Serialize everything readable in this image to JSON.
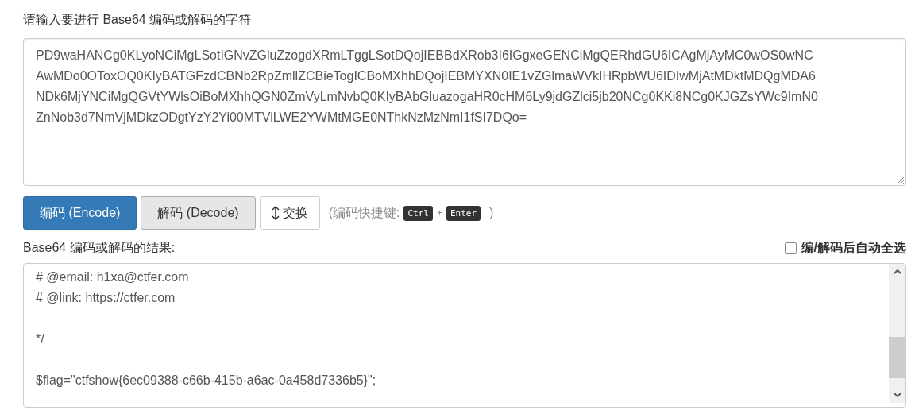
{
  "input": {
    "label": "请输入要进行 Base64 编码或解码的字符",
    "lines": [
      "PD9waHANCg0KLyoNCiMgLSotIGNvZGluZzogdXRmLTggLSotDQojIEBBdXRob3I6IGgxeGENCiMgQERhdGU6ICAgMjAyMC0wOS0wNC",
      "AwMDo0OToxOQ0KIyBATGFzdCBNb2RpZmllZCBieTogICBoMXhhDQojIEBMYXN0IE1vZGlmaWVkIHRpbWU6IDIwMjAtMDktMDQgMDA6",
      "NDk6MjYNCiMgQGVtYWlsOiBoMXhhQGN0ZmVyLmNvbQ0KIyBAbGluazogaHR0cHM6Ly9jdGZlci5jb20NCg0KKi8NCg0KJGZsYWc9ImN0",
      "ZnNob3d7NmVjMDkzODgtYzY2Yi00MTViLWE2YWMtMGE0NThkNzMzNmI1fSI7DQo="
    ]
  },
  "buttons": [
    {
      "kind": "primary",
      "label": "编码 (Encode)"
    },
    {
      "kind": "default",
      "label": "解码 (Decode)"
    },
    {
      "kind": "swap",
      "label": "交换"
    }
  ],
  "shortcut": {
    "prefix": "(编码快捷键:",
    "keys": [
      "Ctrl",
      "Enter"
    ],
    "joiner": "+",
    "suffix": ")"
  },
  "result": {
    "label": "Base64 编码或解码的结果:",
    "auto_select": {
      "label": "编/解码后自动全选",
      "checked": false
    },
    "lines": [
      {
        "kind": "text",
        "text": "# @email: h1xa@ctfer.com"
      },
      {
        "kind": "text",
        "text": "# @link: https://ctfer.com"
      },
      {
        "kind": "blank"
      },
      {
        "kind": "text",
        "text": "*/"
      },
      {
        "kind": "blank"
      },
      {
        "kind": "text",
        "text": "$flag=\"ctfshow{6ec09388-c66b-415b-a6ac-0a458d7336b5}\";"
      },
      {
        "kind": "blank"
      }
    ]
  }
}
